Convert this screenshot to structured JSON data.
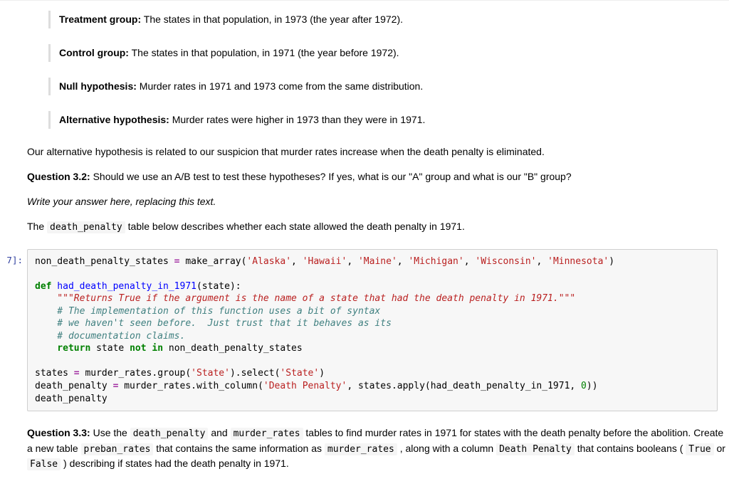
{
  "blockquotes": [
    {
      "label": "Treatment group:",
      "text": " The states in that population, in 1973 (the year after 1972)."
    },
    {
      "label": "Control group:",
      "text": " The states in that population, in 1971 (the year before 1972)."
    },
    {
      "label": "Null hypothesis:",
      "text": " Murder rates in 1971 and 1973 come from the same distribution."
    },
    {
      "label": "Alternative hypothesis:",
      "text": " Murder rates were higher in 1973 than they were in 1971."
    }
  ],
  "alt_suspicion": "Our alternative hypothesis is related to our suspicion that murder rates increase when the death penalty is eliminated.",
  "q32": {
    "label": "Question 3.2:",
    "text": " Should we use an A/B test to test these hypotheses? If yes, what is our \"A\" group and what is our \"B\" group?"
  },
  "placeholder_answer": "Write your answer here, replacing this text.",
  "dp_intro_pre": "The ",
  "dp_intro_code": "death_penalty",
  "dp_intro_post": " table below describes whether each state allowed the death penalty in 1971.",
  "prompt7": "7]:",
  "code": {
    "l1a": "non_death_penalty_states ",
    "l1op": "=",
    "l1b": " make_array(",
    "s_alaska": "'Alaska'",
    "s_hawaii": "'Hawaii'",
    "s_maine": "'Maine'",
    "s_michigan": "'Michigan'",
    "s_wisconsin": "'Wisconsin'",
    "s_minnesota": "'Minnesota'",
    "comma": ", ",
    "rparen": ")",
    "blank": "",
    "def_kw": "def",
    "fn_name": " had_death_penalty_in_1971",
    "fn_sig": "(state):",
    "doc": "    \"\"\"Returns True if the argument is the name of a state that had the death penalty in 1971.\"\"\"",
    "c1": "    # The implementation of this function uses a bit of syntax",
    "c2": "    # we haven't seen before.  Just trust that it behaves as its",
    "c3": "    # documentation claims.",
    "ret_kw": "    return",
    "ret_body1": " state ",
    "not_kw": "not",
    "sp": " ",
    "in_kw": "in",
    "ret_body2": " non_death_penalty_states",
    "l_states_a": "states ",
    "l_states_b": " murder_rates",
    "dot": ".",
    "group": "group(",
    "s_state": "'State'",
    "rp": ")",
    "select": "select(",
    "l_dp_a": "death_penalty ",
    "withcol": "with_column(",
    "s_dp": "'Death Penalty'",
    "comma2": ", states",
    "apply": "apply(had_death_penalty_in_1971, ",
    "zero": "0",
    "rparen2": "))",
    "last": "death_penalty"
  },
  "q33": {
    "label": "Question 3.3:",
    "pre": " Use the ",
    "code1": "death_penalty",
    "mid1": " and ",
    "code2": "murder_rates",
    "mid2": " tables to find murder rates in 1971 for states with the death penalty before the abolition. Create a new table ",
    "code3": "preban_rates",
    "mid3": " that contains the same information as ",
    "code4": "murder_rates",
    "mid4": " , along with a column ",
    "code5": "Death Penalty",
    "mid5": " that contains booleans ( ",
    "code6": "True",
    "mid6": " or ",
    "code7": "False",
    "mid7": " ) describing if states had the death penalty in 1971."
  }
}
